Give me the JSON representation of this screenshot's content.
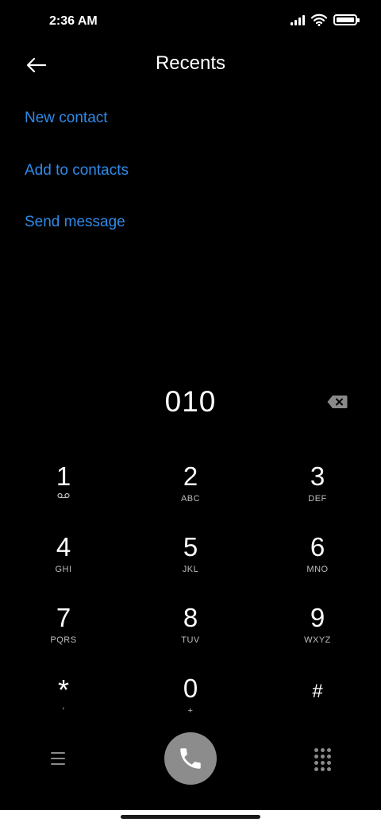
{
  "status_bar": {
    "time": "2:36 AM",
    "icons": [
      "signal-icon",
      "wifi-icon",
      "battery-icon"
    ]
  },
  "header": {
    "title": "Recents",
    "back_icon": "arrow-left-icon"
  },
  "actions": [
    {
      "label": "New contact"
    },
    {
      "label": "Add to contacts"
    },
    {
      "label": "Send message"
    }
  ],
  "dialer": {
    "number": "010",
    "backspace_icon": "backspace-icon",
    "keys": [
      {
        "digit": "1",
        "sub": "",
        "sub_icon": "voicemail-icon"
      },
      {
        "digit": "2",
        "sub": "ABC"
      },
      {
        "digit": "3",
        "sub": "DEF"
      },
      {
        "digit": "4",
        "sub": "GHI"
      },
      {
        "digit": "5",
        "sub": "JKL"
      },
      {
        "digit": "6",
        "sub": "MNO"
      },
      {
        "digit": "7",
        "sub": "PQRS"
      },
      {
        "digit": "8",
        "sub": "TUV"
      },
      {
        "digit": "9",
        "sub": "WXYZ"
      },
      {
        "digit": "*",
        "sub": ","
      },
      {
        "digit": "0",
        "sub": "+"
      },
      {
        "digit": "#",
        "sub": ""
      }
    ]
  },
  "bottom_bar": {
    "menu_icon": "menu-icon",
    "call_icon": "phone-icon",
    "dialpad_icon": "dialpad-icon"
  },
  "colors": {
    "accent": "#2f8ae8",
    "background": "#000000",
    "call_button": "#8c8c8c"
  }
}
